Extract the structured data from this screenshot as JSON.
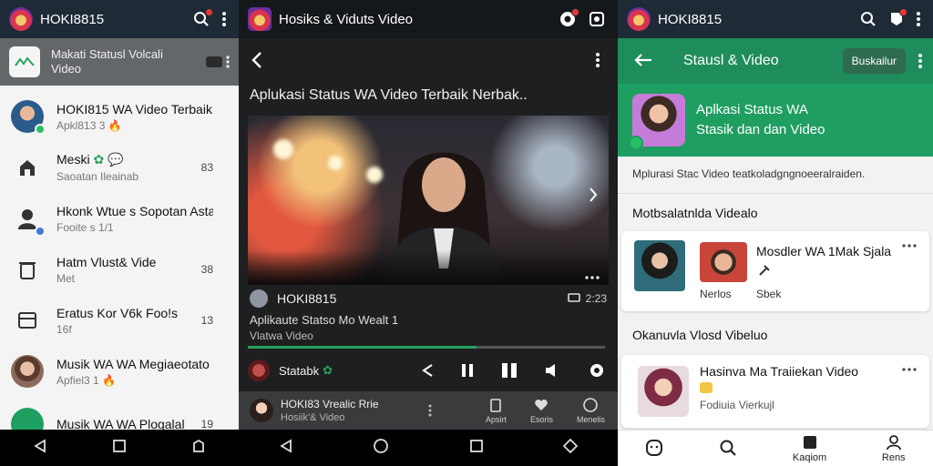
{
  "panel1": {
    "app_title": "HOKI8815",
    "banner": {
      "line1": "Makati Statusl Volcali",
      "line2": "Video"
    },
    "chats": [
      {
        "name": "HOKI815 WA Video Terbaik",
        "sub": "Apkl813 3",
        "count": ""
      },
      {
        "name": "Meski",
        "sub": "Saoatan Ileainab",
        "count": "83"
      },
      {
        "name": "Hkonk Wtue s Sopotan Astaa.",
        "sub": "Fooite s 1/1",
        "count": ""
      },
      {
        "name": "Hatm Vlust& Vide",
        "sub": "Met",
        "count": "38"
      },
      {
        "name": "Eratus Kor V6k Foo!s",
        "sub": "16f",
        "count": "13"
      },
      {
        "name": "Musik WA WA Megiaeotato",
        "sub": "Apfiel3 1",
        "count": ""
      },
      {
        "name": "Musik WA WA Plogalal",
        "sub": "",
        "count": "19"
      }
    ]
  },
  "panel2": {
    "app_title": "Hosiks & Viduts Video",
    "heading": "Aplukasi Status WA Video Terbaik Nerbak..",
    "channel": "HOKI8815",
    "duration": "2:23",
    "desc1": "Aplikaute Statso Mo Wealt 1",
    "desc2": "Vlatwa Video",
    "progress": 0.64,
    "status_label": "Statabk",
    "mini": {
      "title": "HOKI83 Vrealic Rrie",
      "sub": "Hosiik'& Video"
    },
    "mini_tabs": [
      "Apsirt",
      "Esoris",
      "Menelis"
    ]
  },
  "panel3": {
    "app_title": "HOKI8815",
    "bar_title": "Stausl & Video",
    "bar_button": "Buskailur",
    "hero_line1": "Aplkasi Status WA",
    "hero_line2": "Stasik dan dan Video",
    "desc": "Mplurasi Stac Video teatkoladgngnoeeralraiden.",
    "section1": "Motbsalatnlda Videalo",
    "card1": {
      "title": "Mosdler WA 1Mak Sjala",
      "label1": "Nerlos",
      "label2": "Sbek"
    },
    "section2": "Okanuvla Vlosd Vibeluo",
    "card2": {
      "title": "Hasinva Ma Traiiekan Video",
      "sub": "Fodiuia Vierkujl"
    },
    "tabs": [
      "",
      "",
      "Kaqiom",
      "Rens"
    ]
  },
  "colors": {
    "green": "#1f9e61",
    "appbar": "#1e2a36",
    "dark": "#1e1f21"
  }
}
